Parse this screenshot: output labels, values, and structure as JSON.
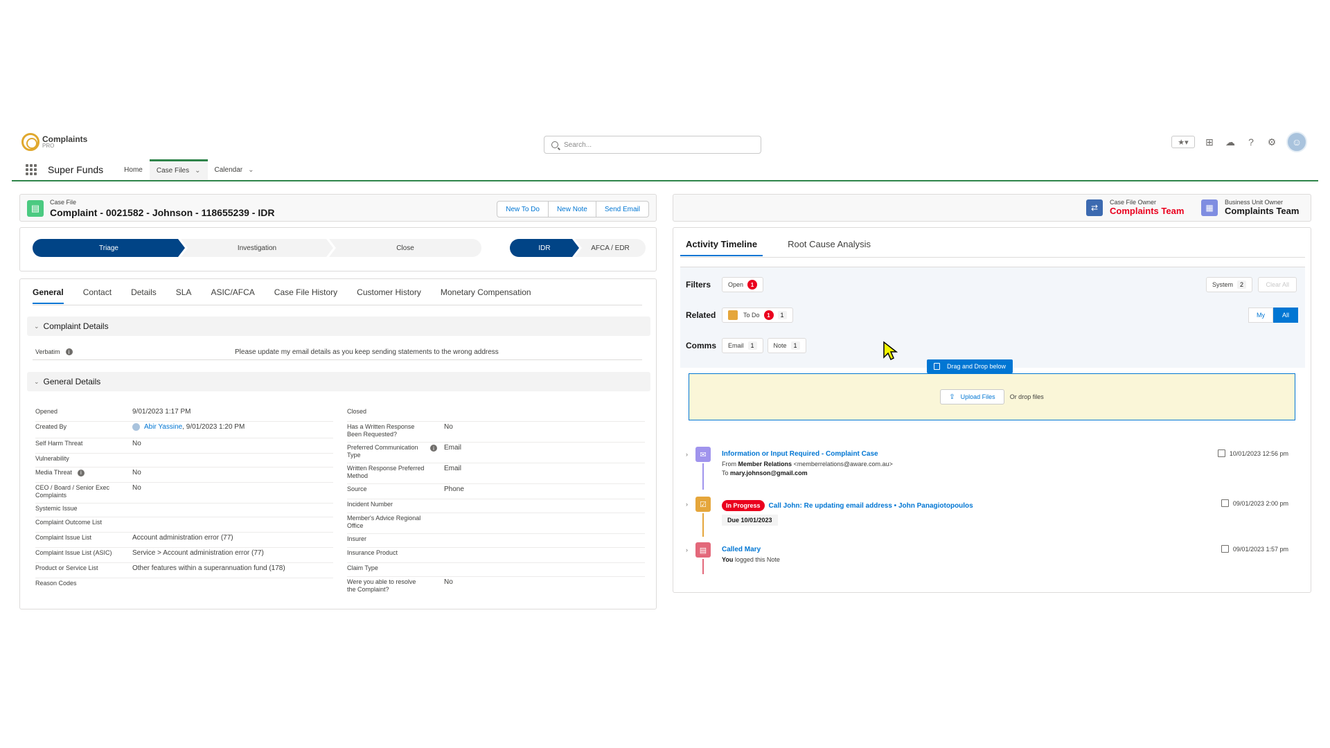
{
  "app": {
    "logo_name": "Complaints",
    "logo_sub": "PRO",
    "name": "Super Funds",
    "search_placeholder": "Search...",
    "nav": [
      {
        "label": "Home"
      },
      {
        "label": "Case Files"
      },
      {
        "label": "Calendar"
      }
    ]
  },
  "case_header": {
    "label": "Case File",
    "title": "Complaint - 0021582 - Johnson - 118655239 - IDR",
    "buttons": [
      "New To Do",
      "New Note",
      "Send Email"
    ]
  },
  "path": {
    "stages": [
      "Triage",
      "Investigation",
      "Close"
    ],
    "secondary": [
      "IDR",
      "AFCA / EDR"
    ]
  },
  "tabs": [
    "General",
    "Contact",
    "Details",
    "SLA",
    "ASIC/AFCA",
    "Case File History",
    "Customer History",
    "Monetary Compensation"
  ],
  "sections": {
    "complaint_details": "Complaint Details",
    "general_details": "General Details"
  },
  "verbatim": {
    "label": "Verbatim",
    "value": "Please update my email details as you keep sending statements to the wrong address"
  },
  "left_fields": [
    {
      "label": "Opened",
      "value": "9/01/2023 1:17 PM"
    },
    {
      "label": "Created By",
      "link": "Abir Yassine",
      "value": ", 9/01/2023 1:20 PM"
    },
    {
      "label": "Self Harm Threat",
      "value": "No"
    },
    {
      "label": "Vulnerability",
      "value": ""
    },
    {
      "label": "Media Threat",
      "value": "No"
    },
    {
      "label": "CEO / Board / Senior Exec Complaints",
      "value": "No"
    },
    {
      "label": "Systemic Issue",
      "value": ""
    },
    {
      "label": "Complaint Outcome List",
      "value": ""
    },
    {
      "label": "Complaint Issue List",
      "value": "Account administration error (77)"
    },
    {
      "label": "Complaint Issue List (ASIC)",
      "value": "Service > Account administration error (77)"
    },
    {
      "label": "Product or Service List",
      "value": "Other features within a superannuation fund (178)"
    },
    {
      "label": "Reason Codes",
      "value": ""
    }
  ],
  "right_fields": [
    {
      "label": "Closed",
      "value": ""
    },
    {
      "label": "Has a Written Response Been Requested?",
      "value": "No"
    },
    {
      "label": "Preferred Communication Type",
      "value": "Email"
    },
    {
      "label": "Written Response Preferred Method",
      "value": "Email"
    },
    {
      "label": "Source",
      "value": "Phone"
    },
    {
      "label": "Incident Number",
      "value": ""
    },
    {
      "label": "Member's Advice Regional Office",
      "value": ""
    },
    {
      "label": "Insurer",
      "value": ""
    },
    {
      "label": "Insurance Product",
      "value": ""
    },
    {
      "label": "Claim Type",
      "value": ""
    },
    {
      "label": "Were you able to resolve the Complaint?",
      "value": "No"
    }
  ],
  "owners": [
    {
      "label": "Case File Owner",
      "name": "Complaints Team",
      "color": "#ea001e"
    },
    {
      "label": "Business Unit Owner",
      "name": "Complaints Team",
      "color": "#181818"
    }
  ],
  "right_tabs": [
    "Activity Timeline",
    "Root Cause Analysis"
  ],
  "filters": {
    "filters_label": "Filters",
    "open_label": "Open",
    "open_count": "1",
    "system_label": "System",
    "system_count": "2",
    "clear_all": "Clear All",
    "related_label": "Related",
    "todo_label": "To Do",
    "todo_red": "1",
    "todo_count": "1",
    "my": "My",
    "all": "All",
    "comms_label": "Comms",
    "email_label": "Email",
    "email_count": "1",
    "note_label": "Note",
    "note_count": "1"
  },
  "upload": {
    "badge": "Drag and Drop below",
    "button": "Upload Files",
    "drop_text": "Or drop files"
  },
  "timeline": [
    {
      "title": "Information or Input Required - Complaint Case",
      "from_prefix": "From",
      "from_name": "Member Relations",
      "from_email": "<memberrelations@aware.com.au>",
      "to_prefix": "To",
      "to": "mary.johnson@gmail.com",
      "date": "10/01/2023 12:56 pm",
      "color": "#a094ed"
    },
    {
      "status": "In Progress",
      "title": "Call John: Re updating email address • John Panagiotopoulos",
      "due": "Due 10/01/2023",
      "date": "09/01/2023 2:00 pm",
      "color": "#e5a63b"
    },
    {
      "title": "Called Mary",
      "sub_bold": "You",
      "sub": "logged this Note",
      "date": "09/01/2023 1:57 pm",
      "color": "#e3687a"
    }
  ]
}
